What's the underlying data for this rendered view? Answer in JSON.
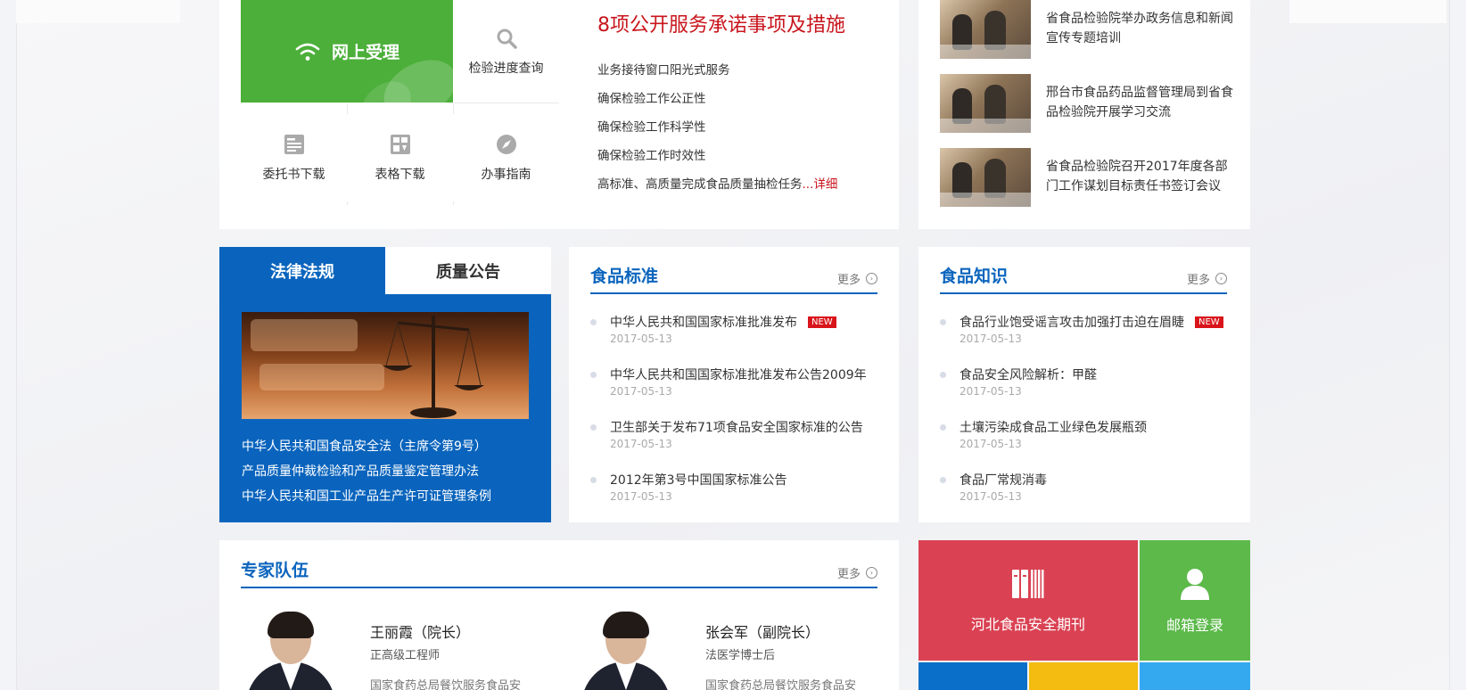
{
  "services": {
    "online": "网上受理",
    "progress": "检验进度查询",
    "commission_download": "委托书下载",
    "form_download": "表格下载",
    "guide": "办事指南"
  },
  "promise": {
    "title": "8项公开服务承诺事项及措施",
    "items": [
      "业务接待窗口阳光式服务",
      "确保检验工作公正性",
      "确保检验工作科学性",
      "确保检验工作时效性"
    ],
    "last_item": "高标准、高质量完成食品质量抽检任务",
    "more": "...详细"
  },
  "news": [
    {
      "title": "省食品检验院举办政务信息和新闻宣传专题培训"
    },
    {
      "title": "邢台市食品药品监督管理局到省食品检验院开展学习交流"
    },
    {
      "title": "省食品检验院召开2017年度各部门工作谋划目标责任书签订会议"
    }
  ],
  "law": {
    "tab_active": "法律法规",
    "tab_inactive": "质量公告",
    "items": [
      "中华人民共和国食品安全法（主席令第9号）",
      "产品质量仲裁检验和产品质量鉴定管理办法",
      "中华人民共和国工业产品生产许可证管理条例"
    ]
  },
  "standards": {
    "title": "食品标准",
    "more": "更多",
    "new_badge": "NEW",
    "items": [
      {
        "title": "中华人民共和国国家标准批准发布",
        "date": "2017-05-13",
        "is_new": true
      },
      {
        "title": "中华人民共和国国家标准批准发布公告2009年",
        "date": "2017-05-13",
        "is_new": false
      },
      {
        "title": "卫生部关于发布71项食品安全国家标准的公告",
        "date": "2017-05-13",
        "is_new": false
      },
      {
        "title": "2012年第3号中国国家标准公告",
        "date": "2017-05-13",
        "is_new": false
      }
    ]
  },
  "knowledge": {
    "title": "食品知识",
    "more": "更多",
    "new_badge": "NEW",
    "items": [
      {
        "title": "食品行业饱受谣言攻击加强打击迫在眉睫",
        "date": "2017-05-13",
        "is_new": true
      },
      {
        "title": "食品安全风险解析：甲醛",
        "date": "2017-05-13",
        "is_new": false
      },
      {
        "title": "土壤污染成食品工业绿色发展瓶颈",
        "date": "2017-05-13",
        "is_new": false
      },
      {
        "title": "食品厂常规消毒",
        "date": "2017-05-13",
        "is_new": false
      }
    ]
  },
  "experts": {
    "title": "专家队伍",
    "more": "更多",
    "people": [
      {
        "name": "王丽霞（院长）",
        "role": "正高级工程师",
        "desc": "国家食药总局餐饮服务食品安"
      },
      {
        "name": "张会军（副院长）",
        "role": "法医学博士后",
        "desc": "国家食药总局餐饮服务食品安"
      }
    ]
  },
  "tiles": {
    "journal": "河北食品安全期刊",
    "mail": "邮箱登录"
  },
  "colors": {
    "brand_blue": "#0a64bd",
    "green": "#4caf3a",
    "red": "#c8161d",
    "tile_red": "#da4253",
    "tile_green": "#5cb94a",
    "tile_blue": "#0a6fc8",
    "tile_yellow": "#f4bb10",
    "tile_sky": "#35a9f0"
  }
}
